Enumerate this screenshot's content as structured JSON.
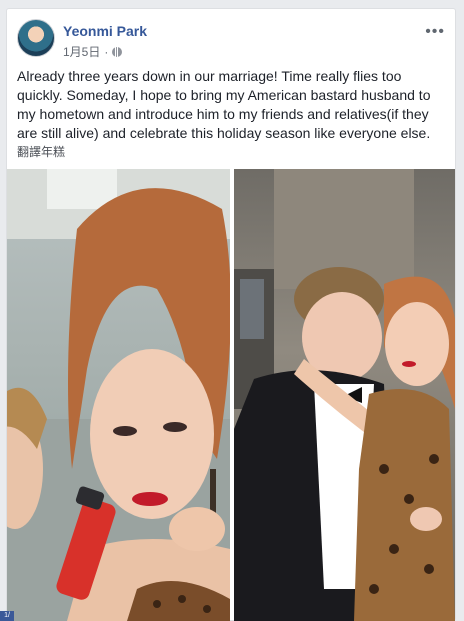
{
  "post": {
    "author": "Yeonmi Park",
    "date": "1月5日",
    "privacy_icon": "globe-icon",
    "text": "Already three years down in our marriage! Time really flies too quickly. Someday, I hope to bring my American bastard husband to my hometown and introduce him to my friends and relatives(if they are still alive) and celebrate this holiday season like everyone else.",
    "translate_label": "翻譯年糕",
    "more_icon": "more-options-icon"
  },
  "photos": [
    {
      "name": "photo-1",
      "description_icon": "photo"
    },
    {
      "name": "photo-2",
      "description_icon": "photo"
    }
  ],
  "colors": {
    "author_link": "#365899",
    "background": "#e9ebee",
    "card": "#ffffff"
  }
}
